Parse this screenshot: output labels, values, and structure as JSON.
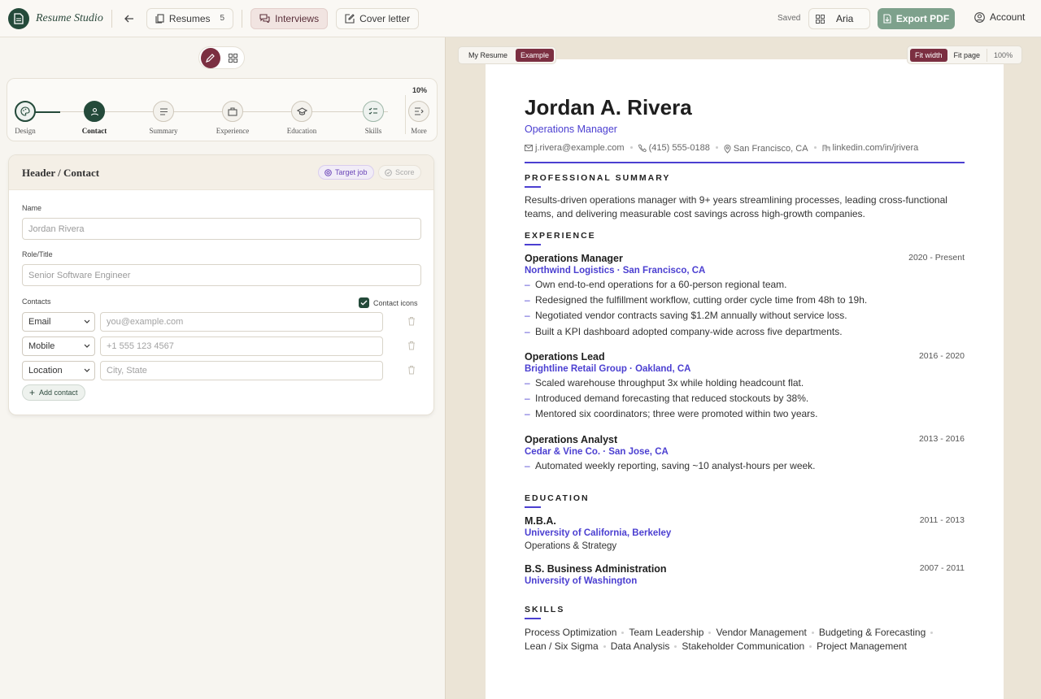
{
  "topbar": {
    "brand": "Resume Studio",
    "resumes_label": "Resumes",
    "resumes_count": "5",
    "interviews_label": "Interviews",
    "cover_letter_label": "Cover letter",
    "saved_status": "Saved",
    "user_name": "Aria",
    "export_label": "Export PDF",
    "account_label": "Account"
  },
  "stepper": {
    "progress": "10%",
    "steps": [
      {
        "label": "Design",
        "state": "done",
        "icon": "palette-icon"
      },
      {
        "label": "Contact",
        "state": "current",
        "icon": "person-icon"
      },
      {
        "label": "Summary",
        "state": "todo",
        "icon": "lines-icon"
      },
      {
        "label": "Experience",
        "state": "todo",
        "icon": "briefcase-icon"
      },
      {
        "label": "Education",
        "state": "todo",
        "icon": "graduation-cap-icon"
      },
      {
        "label": "Skills",
        "state": "done",
        "icon": "checklist-icon"
      },
      {
        "label": "More",
        "state": "todo",
        "icon": "list-more-icon"
      }
    ]
  },
  "editor": {
    "title": "Header / Contact",
    "target_job_label": "Target job",
    "score_label": "Score",
    "name_label": "Name",
    "name_placeholder": "Jordan Rivera",
    "role_label": "Role/Title",
    "role_placeholder": "Senior Software Engineer",
    "contacts_label": "Contacts",
    "contact_icons_label": "Contact icons",
    "contact_rows": [
      {
        "type": "Email",
        "placeholder": "you@example.com"
      },
      {
        "type": "Mobile",
        "placeholder": "+1 555 123 4567"
      },
      {
        "type": "Location",
        "placeholder": "City, State"
      }
    ],
    "add_contact_label": "Add contact"
  },
  "preview": {
    "tab_my_resume": "My Resume",
    "tab_example": "Example",
    "fit_width": "Fit width",
    "fit_page": "Fit page",
    "zoom": "100%"
  },
  "resume": {
    "name": "Jordan A. Rivera",
    "role": "Operations Manager",
    "email": "j.rivera@example.com",
    "phone": "(415) 555-0188",
    "location": "San Francisco, CA",
    "linkedin": "linkedin.com/in/jrivera",
    "summary_heading": "PROFESSIONAL SUMMARY",
    "summary_line1": "Results-driven operations manager with 9+ years streamlining processes, leading cross-functional",
    "summary_line2": "teams, and delivering measurable cost savings across high-growth companies.",
    "experience_heading": "EXPERIENCE",
    "jobs": [
      {
        "title": "Operations Manager",
        "dates": "2020 - Present",
        "org": "Northwind Logistics · San Francisco, CA",
        "bullets": [
          "Own end-to-end operations for a 60-person regional team.",
          "Redesigned the fulfillment workflow, cutting order cycle time from 48h to 19h.",
          "Negotiated vendor contracts saving $1.2M annually without service loss.",
          "Built a KPI dashboard adopted company-wide across five departments."
        ]
      },
      {
        "title": "Operations Lead",
        "dates": "2016 - 2020",
        "org": "Brightline Retail Group · Oakland, CA",
        "bullets": [
          "Scaled warehouse throughput 3x while holding headcount flat.",
          "Introduced demand forecasting that reduced stockouts by 38%.",
          "Mentored six coordinators; three were promoted within two years."
        ]
      },
      {
        "title": "Operations Analyst",
        "dates": "2013 - 2016",
        "org": "Cedar & Vine Co. · San Jose, CA",
        "bullets": [
          "Automated weekly reporting, saving ~10 analyst-hours per week."
        ]
      }
    ],
    "education_heading": "EDUCATION",
    "education": [
      {
        "degree": "M.B.A.",
        "dates": "2011 - 2013",
        "school": "University of California, Berkeley",
        "detail": "Operations & Strategy"
      },
      {
        "degree": "B.S. Business Administration",
        "dates": "2007 - 2011",
        "school": "University of Washington",
        "detail": ""
      }
    ],
    "skills_heading": "SKILLS",
    "skills_row1": [
      "Process Optimization",
      "Team Leadership",
      "Vendor Management",
      "Budgeting & Forecasting"
    ],
    "skills_row2": [
      "Lean / Six Sigma",
      "Data Analysis",
      "Stakeholder Communication",
      "Project Management"
    ]
  },
  "colors": {
    "brand_green": "#244a3a",
    "accent_maroon": "#7b2f41",
    "resume_accent": "#4b3fd1"
  }
}
